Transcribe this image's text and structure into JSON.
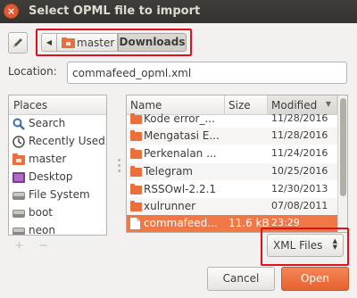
{
  "window": {
    "title": "Select OPML file to import",
    "close_glyph": "×"
  },
  "pathbar": {
    "back_glyph": "◀",
    "crumbs": [
      "master",
      "Downloads"
    ]
  },
  "location": {
    "label": "Location:",
    "value": "commafeed_opml.xml"
  },
  "places": {
    "header": "Places",
    "items": [
      {
        "label": "Search",
        "icon": "search-icon"
      },
      {
        "label": "Recently Used",
        "icon": "recent-icon"
      },
      {
        "label": "master",
        "icon": "home-folder-icon"
      },
      {
        "label": "Desktop",
        "icon": "desktop-icon"
      },
      {
        "label": "File System",
        "icon": "drive-icon"
      },
      {
        "label": "boot",
        "icon": "drive-icon"
      },
      {
        "label": "neon",
        "icon": "drive-icon"
      }
    ],
    "add_glyph": "+",
    "remove_glyph": "−"
  },
  "files": {
    "columns": {
      "name": "Name",
      "size": "Size",
      "modified": "Modified",
      "sort_glyph": "▼"
    },
    "rows": [
      {
        "name": "Kode error_...",
        "size": "",
        "modified": "11/28/2016",
        "type": "folder"
      },
      {
        "name": "Mengatasi E...",
        "size": "",
        "modified": "11/28/2016",
        "type": "folder"
      },
      {
        "name": "Perkenalan ...",
        "size": "",
        "modified": "11/24/2016",
        "type": "folder"
      },
      {
        "name": "Telegram",
        "size": "",
        "modified": "10/25/2016",
        "type": "folder"
      },
      {
        "name": "RSSOwl-2.2.1",
        "size": "",
        "modified": "12/30/2013",
        "type": "folder"
      },
      {
        "name": "xulrunner",
        "size": "",
        "modified": "07/08/2011",
        "type": "folder"
      },
      {
        "name": "commafeed...",
        "size": "11.6 kB",
        "modified": "23:29",
        "type": "file",
        "selected": true
      }
    ]
  },
  "filter": {
    "value": "XML Files",
    "updown_glyph_up": "▲",
    "updown_glyph_down": "▼"
  },
  "buttons": {
    "cancel": "Cancel",
    "open": "Open"
  },
  "colors": {
    "accent": "#f07746",
    "highlight_frame": "#e1101b",
    "titlebar": "#3c3b37"
  }
}
